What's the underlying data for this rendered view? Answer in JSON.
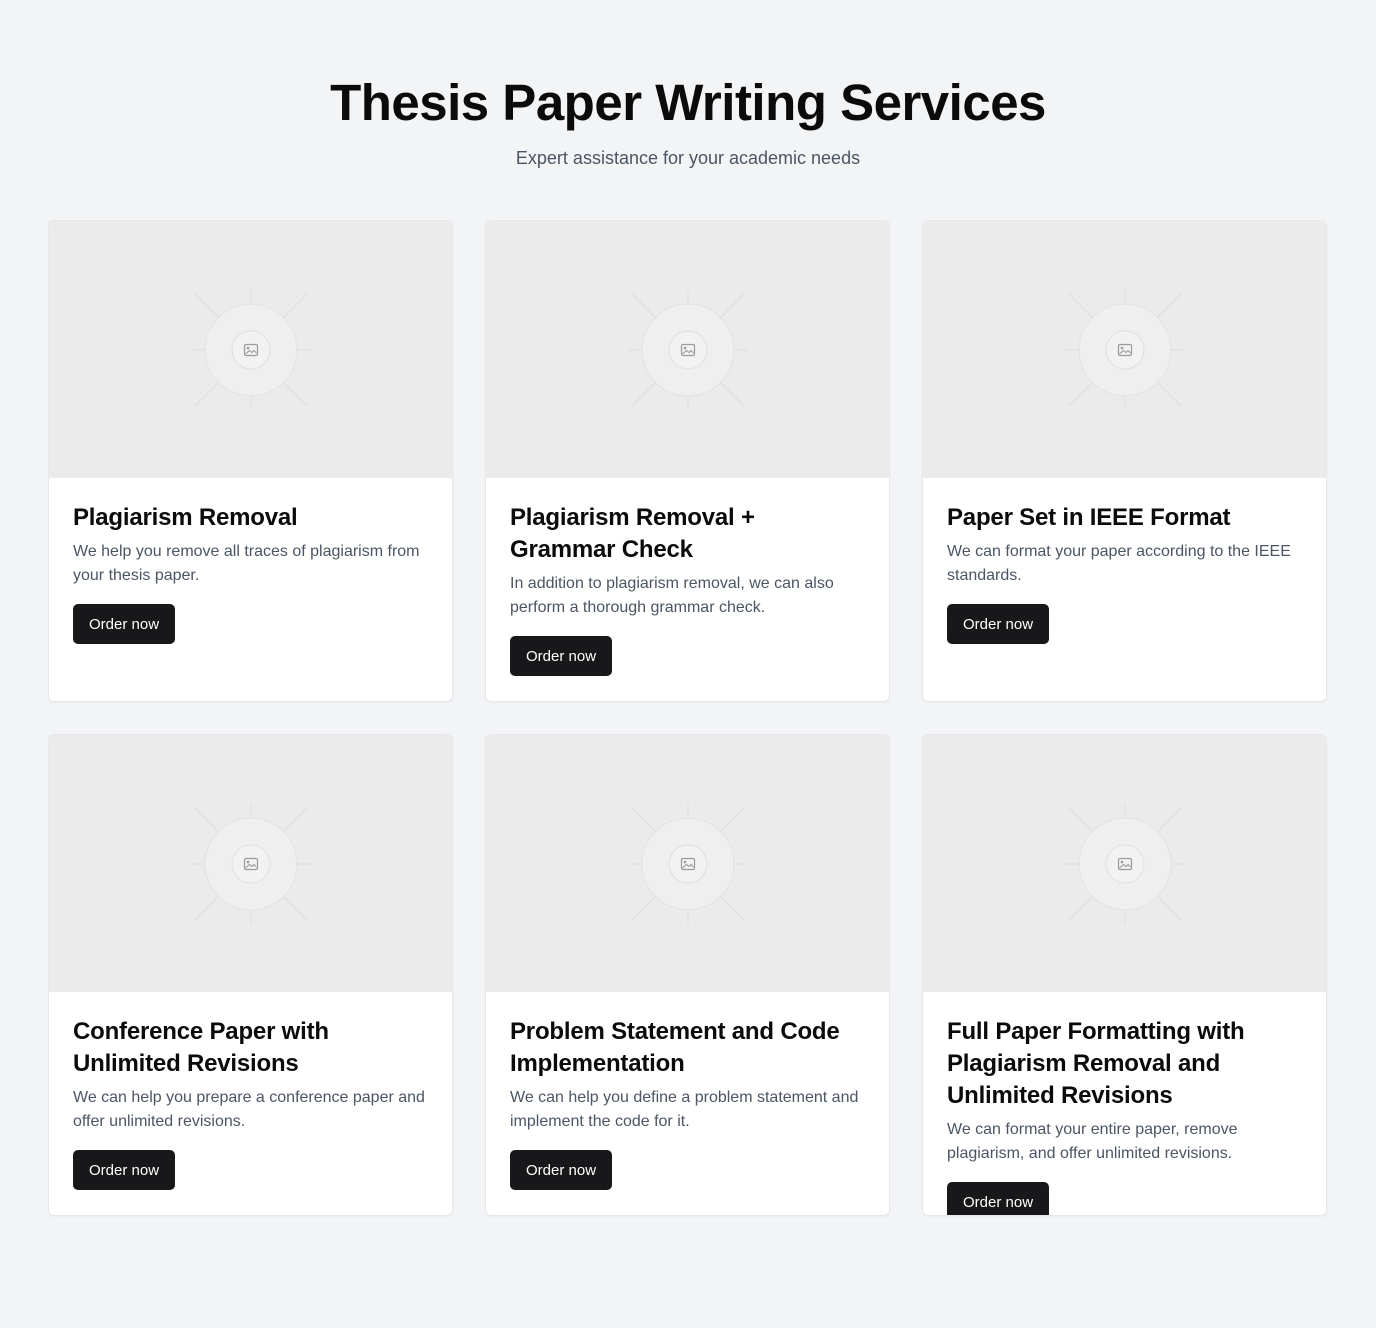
{
  "header": {
    "title": "Thesis Paper Writing Services",
    "subtitle": "Expert assistance for your academic needs"
  },
  "cards": [
    {
      "title": "Plagiarism Removal",
      "description": "We help you remove all traces of plagiarism from your thesis paper.",
      "button_label": "Order now",
      "image_icon": "image-placeholder-icon"
    },
    {
      "title": "Plagiarism Removal + Grammar Check",
      "description": "In addition to plagiarism removal, we can also perform a thorough grammar check.",
      "button_label": "Order now",
      "image_icon": "image-placeholder-icon"
    },
    {
      "title": "Paper Set in IEEE Format",
      "description": "We can format your paper according to the IEEE standards.",
      "button_label": "Order now",
      "image_icon": "image-placeholder-icon"
    },
    {
      "title": "Conference Paper with Unlimited Revisions",
      "description": "We can help you prepare a conference paper and offer unlimited revisions.",
      "button_label": "Order now",
      "image_icon": "image-placeholder-icon"
    },
    {
      "title": "Problem Statement and Code Implementation",
      "description": "We can help you define a problem statement and implement the code for it.",
      "button_label": "Order now",
      "image_icon": "image-placeholder-icon"
    },
    {
      "title": "Full Paper Formatting with Plagiarism Removal and Unlimited Revisions",
      "description": "We can format your entire paper, remove plagiarism, and offer unlimited revisions.",
      "button_label": "Order now",
      "image_icon": "image-placeholder-icon"
    }
  ],
  "colors": {
    "page_background": "#f3f4f6",
    "card_background": "#ffffff",
    "thumbnail_background": "#ebebeb",
    "button_background": "#18181b",
    "button_text": "#ffffff",
    "muted_text": "#4b5563"
  }
}
